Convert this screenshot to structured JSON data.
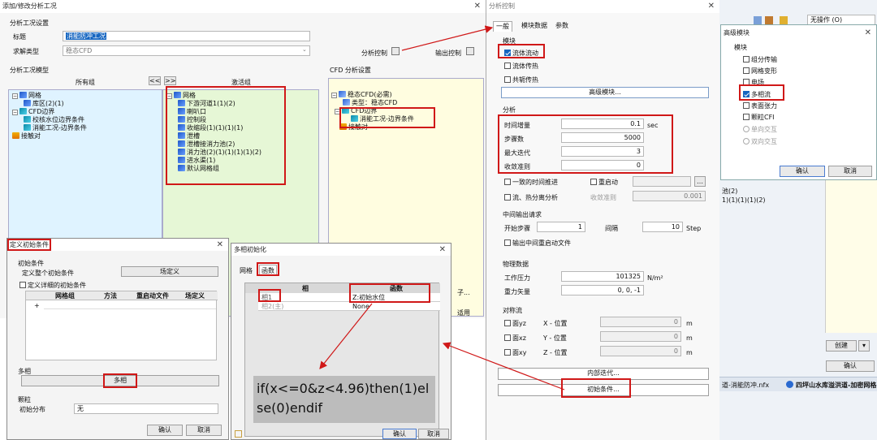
{
  "main": {
    "title": "添加/修改分析工况",
    "setup_group": "分析工况设置",
    "title_label": "标题",
    "title_value": "消能防冲工况",
    "solver_label": "求解类型",
    "solver_value": "稳态CFD",
    "analysis_control": "分析控制",
    "output_control": "输出控制",
    "model_group": "分析工况模型",
    "all_groups": "所有组",
    "activated_groups": "激活组",
    "left_tree": [
      "网格",
      "库区(2)(1)",
      "CFD边界",
      "校核水位边界条件",
      "消能工况-边界条件",
      "接触对"
    ],
    "right_tree": [
      "网格",
      "下游河道1(1)(2)",
      "喇叭口",
      "控制段",
      "收缩段(1)(1)(1)(1)",
      "泄槽",
      "泄槽接消力池(2)",
      "消力池(2)(1)(1)(1)(1)(2)",
      "进水渠(1)",
      "默认网格组"
    ],
    "cfd_setup_group": "CFD 分析设置",
    "cfd_tree": [
      "稳态CFD(必需)",
      "类型：稳态CFD",
      "CFD边界",
      "消能工况-边界条件",
      "接触对"
    ],
    "arrows": [
      "<<",
      ">>"
    ]
  },
  "control": {
    "title": "分析控制",
    "tabs": [
      "一般",
      "模块数据",
      "参数"
    ],
    "module_group": "模块",
    "modules": [
      "流体流动",
      "流体传热",
      "共轭传热"
    ],
    "advanced_btn": "高级模块...",
    "analysis_group": "分析",
    "params": [
      {
        "label": "时间增量",
        "value": "0.1",
        "unit": "sec"
      },
      {
        "label": "步骤数",
        "value": "5000",
        "unit": ""
      },
      {
        "label": "最大迭代",
        "value": "3",
        "unit": ""
      },
      {
        "label": "收敛准则",
        "value": "0",
        "unit": ""
      }
    ],
    "consistent_time": "一致的时间推进",
    "restart": "重启动",
    "flow_heat": "流、热分离分析",
    "conv_label": "收敛准则",
    "conv_value": "0.001",
    "mid_group": "中间输出请求",
    "start_step": "开始步骤",
    "start_value": "1",
    "interval": "间隔",
    "interval_value": "10",
    "step_unit": "Step",
    "output_restart": "输出中间重启动文件",
    "phys_group": "物理数据",
    "pressure_label": "工作压力",
    "pressure_value": "101325",
    "pressure_unit": "N/m²",
    "gravity_label": "重力矢量",
    "gravity_value": "0, 0, -1",
    "sym_group": "对称流",
    "planes": [
      {
        "label": "面yz",
        "pos": "X - 位置",
        "value": "0",
        "unit": "m"
      },
      {
        "label": "面xz",
        "pos": "Y - 位置",
        "value": "0",
        "unit": "m"
      },
      {
        "label": "面xy",
        "pos": "Z - 位置",
        "value": "0",
        "unit": "m"
      }
    ],
    "inner_iter": "内部迭代...",
    "init_cond": "初始条件..."
  },
  "adv": {
    "title": "高级模块",
    "group": "模块",
    "items": [
      "组分传输",
      "网格变形",
      "电场",
      "多相流",
      "表面张力",
      "颗粒CFI"
    ],
    "single": "单向交互",
    "two": "双向交互",
    "ok": "确认",
    "cancel": "取消"
  },
  "bg": {
    "toolbar_text": "无操作 (O)",
    "texts": [
      "池(2)",
      "1)(1)(1)(1)(2)"
    ],
    "create": "创建",
    "ok": "确认",
    "tabs": [
      "道-消能防冲.nfx",
      "四坪山水库溢洪道-加密网格"
    ],
    "side_labels": [
      "子...",
      "适用"
    ]
  },
  "init": {
    "title": "定义初始条件",
    "group": "初始条件",
    "define_all": "定义整个初始条件",
    "field_def": "场定义",
    "detail": "定义详细的初始条件",
    "cols": [
      "网格组",
      "方法",
      "重启动文件",
      "场定义"
    ],
    "multiphase_group": "多相",
    "multiphase_btn": "多相",
    "particle_group": "颗粒",
    "init_dist": "初始分布",
    "dist_value": "无",
    "ok": "确认",
    "cancel": "取消"
  },
  "mp": {
    "title": "多相初始化",
    "tabs": [
      "网格",
      "函数"
    ],
    "col_phase": "相",
    "col_func": "函数",
    "rows": [
      {
        "phase": "相1",
        "func": "Z:初始水位"
      },
      {
        "phase": "相2(主)",
        "func": "None"
      }
    ],
    "formula": "if(x<=0&z<4.96)then(1)else(0)endif",
    "ok": "确认",
    "cancel": "取消"
  },
  "colors": {
    "accent": "#d01818",
    "select": "#1565c0",
    "tree_bg": "#dff3ff",
    "active_bg": "#e6f7d6",
    "cfd_bg": "#fffde0"
  }
}
